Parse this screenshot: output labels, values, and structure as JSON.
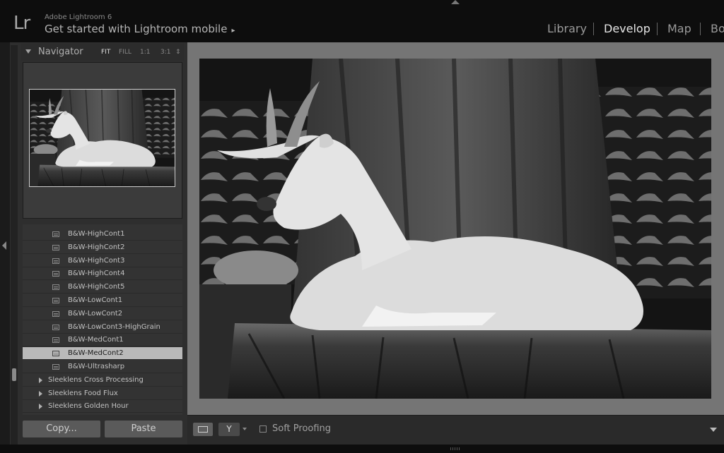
{
  "app": {
    "logo": "Lr",
    "brand": "Adobe Lightroom 6",
    "identity_plate": "Get started with Lightroom mobile",
    "identity_arrow": "▸"
  },
  "modules": [
    {
      "label": "Library",
      "active": false
    },
    {
      "label": "Develop",
      "active": true
    },
    {
      "label": "Map",
      "active": false
    },
    {
      "label": "Bo",
      "active": false
    }
  ],
  "navigator": {
    "title": "Navigator",
    "zoom_options": [
      "FIT",
      "FILL",
      "1:1",
      "3:1"
    ],
    "zoom_stepper": "⇕",
    "selected_zoom": "FIT"
  },
  "presets": {
    "items": [
      "B&W-HighCont1",
      "B&W-HighCont2",
      "B&W-HighCont3",
      "B&W-HighCont4",
      "B&W-HighCont5",
      "B&W-LowCont1",
      "B&W-LowCont2",
      "B&W-LowCont3-HighGrain",
      "B&W-MedCont1",
      "B&W-MedCont2",
      "B&W-Ultrasharp"
    ],
    "selected": "B&W-MedCont2",
    "folders": [
      "Sleeklens Cross Processing",
      "Sleeklens Food Flux",
      "Sleeklens Golden Hour"
    ]
  },
  "left_buttons": {
    "copy": "Copy...",
    "paste": "Paste"
  },
  "toolbar": {
    "compare_glyph": "Y",
    "soft_proofing": "Soft Proofing"
  },
  "colors": {
    "background": "#000000",
    "panel": "#2e2e2e",
    "selected_row": "#b9b9b9",
    "loupe_bg": "#757575"
  }
}
